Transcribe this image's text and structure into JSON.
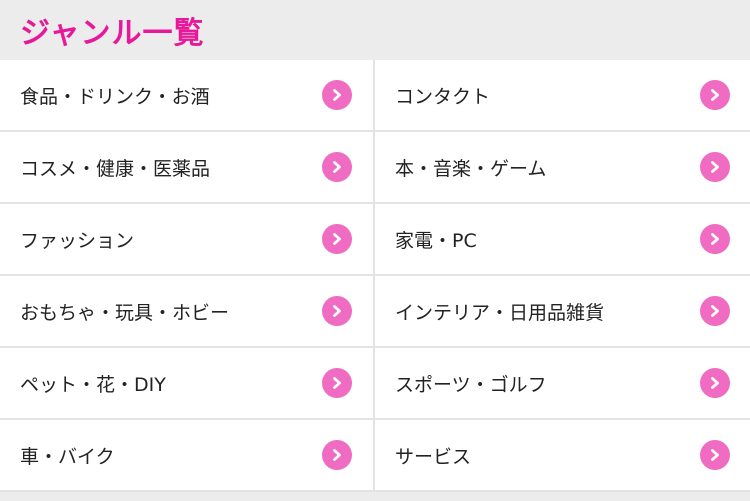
{
  "header": {
    "title": "ジャンル一覧"
  },
  "genres": [
    {
      "label": "食品・ドリンク・お酒"
    },
    {
      "label": "コンタクト"
    },
    {
      "label": "コスメ・健康・医薬品"
    },
    {
      "label": "本・音楽・ゲーム"
    },
    {
      "label": "ファッション"
    },
    {
      "label": "家電・PC"
    },
    {
      "label": "おもちゃ・玩具・ホビー"
    },
    {
      "label": "インテリア・日用品雑貨"
    },
    {
      "label": "ペット・花・DIY"
    },
    {
      "label": "スポーツ・ゴルフ"
    },
    {
      "label": "車・バイク"
    },
    {
      "label": "サービス"
    }
  ],
  "icons": {
    "item_arrow": "chevron-right-icon"
  },
  "colors": {
    "accent": "#e8189a",
    "arrow_bg": "#f06cc3",
    "header_bg": "#ececec",
    "divider": "#e3e3e3"
  }
}
